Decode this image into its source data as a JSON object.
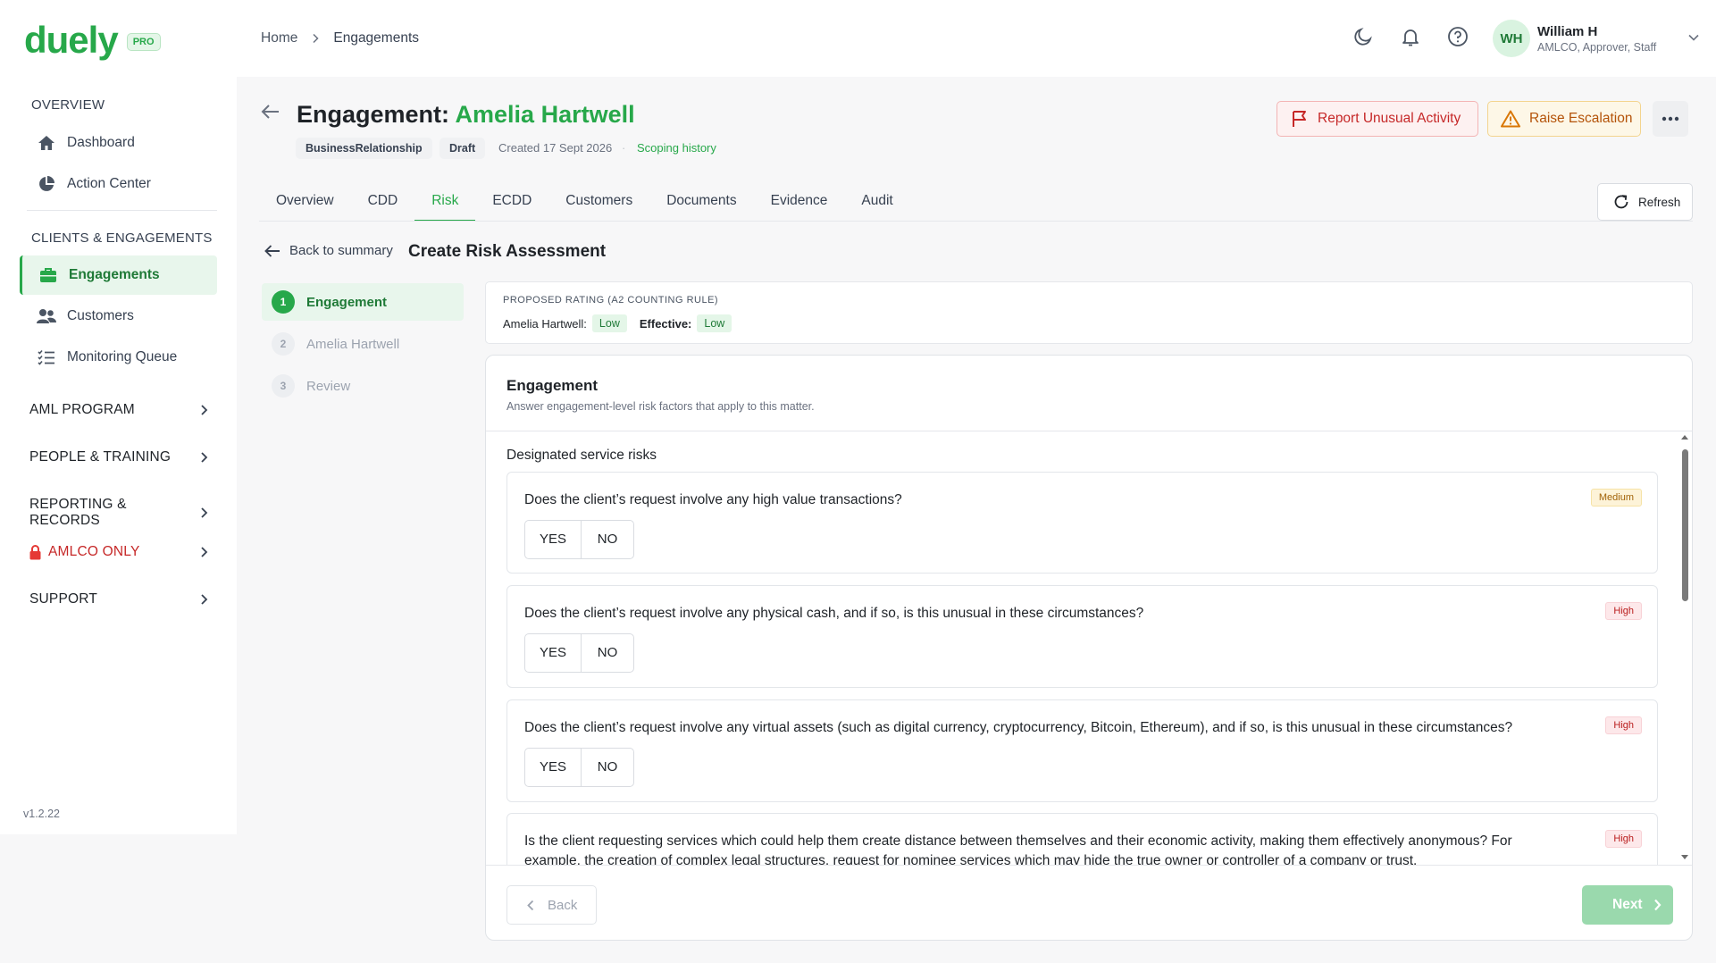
{
  "brand": {
    "name": "duely",
    "tier": "PRO"
  },
  "sidebar": {
    "overview_heading": "OVERVIEW",
    "overview_items": [
      {
        "label": "Dashboard"
      },
      {
        "label": "Action Center"
      }
    ],
    "clients_heading": "CLIENTS & ENGAGEMENTS",
    "clients_items": [
      {
        "label": "Engagements"
      },
      {
        "label": "Customers"
      },
      {
        "label": "Monitoring Queue"
      }
    ],
    "groups": [
      {
        "label": "AML PROGRAM"
      },
      {
        "label": "PEOPLE & TRAINING"
      },
      {
        "label": "REPORTING & RECORDS"
      },
      {
        "label": "AMLCO ONLY"
      },
      {
        "label": "SUPPORT"
      }
    ],
    "version": "v1.2.22"
  },
  "breadcrumb": {
    "home": "Home",
    "current": "Engagements"
  },
  "user": {
    "initials": "WH",
    "name": "William H",
    "role": "AMLCO, Approver, Staff"
  },
  "header": {
    "title_prefix": "Engagement:",
    "title_name": "Amelia Hartwell",
    "type_chip": "BusinessRelationship",
    "status_chip": "Draft",
    "created": "Created 17 Sept 2026",
    "scoping_link": "Scoping history",
    "report_button": "Report Unusual Activity",
    "escalation_button": "Raise Escalation"
  },
  "tabs": [
    {
      "label": "Overview"
    },
    {
      "label": "CDD"
    },
    {
      "label": "Risk"
    },
    {
      "label": "ECDD"
    },
    {
      "label": "Customers"
    },
    {
      "label": "Documents"
    },
    {
      "label": "Evidence"
    },
    {
      "label": "Audit"
    }
  ],
  "active_tab": "Risk",
  "refresh_label": "Refresh",
  "subheader": {
    "back_label": "Back to summary",
    "title": "Create Risk Assessment"
  },
  "steps": [
    {
      "num": "1",
      "label": "Engagement"
    },
    {
      "num": "2",
      "label": "Amelia Hartwell"
    },
    {
      "num": "3",
      "label": "Review"
    }
  ],
  "rating": {
    "heading": "PROPOSED RATING (A2 COUNTING RULE)",
    "client_label": "Amelia Hartwell:",
    "client_value": "Low",
    "effective_label": "Effective:",
    "effective_value": "Low"
  },
  "panel": {
    "title": "Engagement",
    "subtitle": "Answer engagement-level risk factors that apply to this matter.",
    "section": "Designated service risks",
    "yes_label": "YES",
    "no_label": "NO",
    "questions": [
      {
        "text": "Does the client’s request involve any high value transactions?",
        "risk": "Medium"
      },
      {
        "text": "Does the client’s request involve any physical cash, and if so, is this unusual in these circumstances?",
        "risk": "High"
      },
      {
        "text": "Does the client’s request involve any virtual assets (such as digital currency, cryptocurrency, Bitcoin, Ethereum), and if so, is this unusual in these circumstances?",
        "risk": "High"
      },
      {
        "text": "Is the client requesting services which could help them create distance between themselves and their economic activity, making them effectively anonymous? For example, the creation of complex legal structures, request for nominee services which may hide the true owner or controller of a company or trust.",
        "risk": "High"
      }
    ],
    "back_button": "Back",
    "next_button": "Next"
  },
  "colors": {
    "brand_green": "#27a84a",
    "danger": "#c62828",
    "warning": "#b45309"
  }
}
